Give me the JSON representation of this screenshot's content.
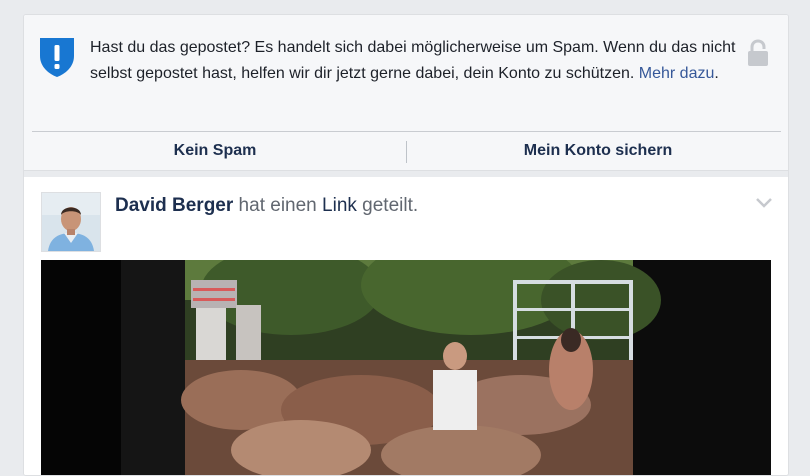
{
  "warning": {
    "text": "Hast du das gepostet? Es handelt sich dabei möglicherweise um Spam. Wenn du das nicht selbst gepostet hast, helfen wir dir jetzt gerne dabei, dein Konto zu schützen. ",
    "more_link": "Mehr dazu",
    "after_link": ".",
    "shield_icon": "shield-alert-icon",
    "lock_icon": "lock-icon",
    "accent_color": "#1877d2"
  },
  "actions": {
    "not_spam": "Kein Spam",
    "secure_account": "Mein Konto sichern"
  },
  "post": {
    "author": "David Berger",
    "verb_before": " hat einen ",
    "link_word": "Link",
    "verb_after": " geteilt.",
    "menu_icon": "chevron-down-icon"
  }
}
